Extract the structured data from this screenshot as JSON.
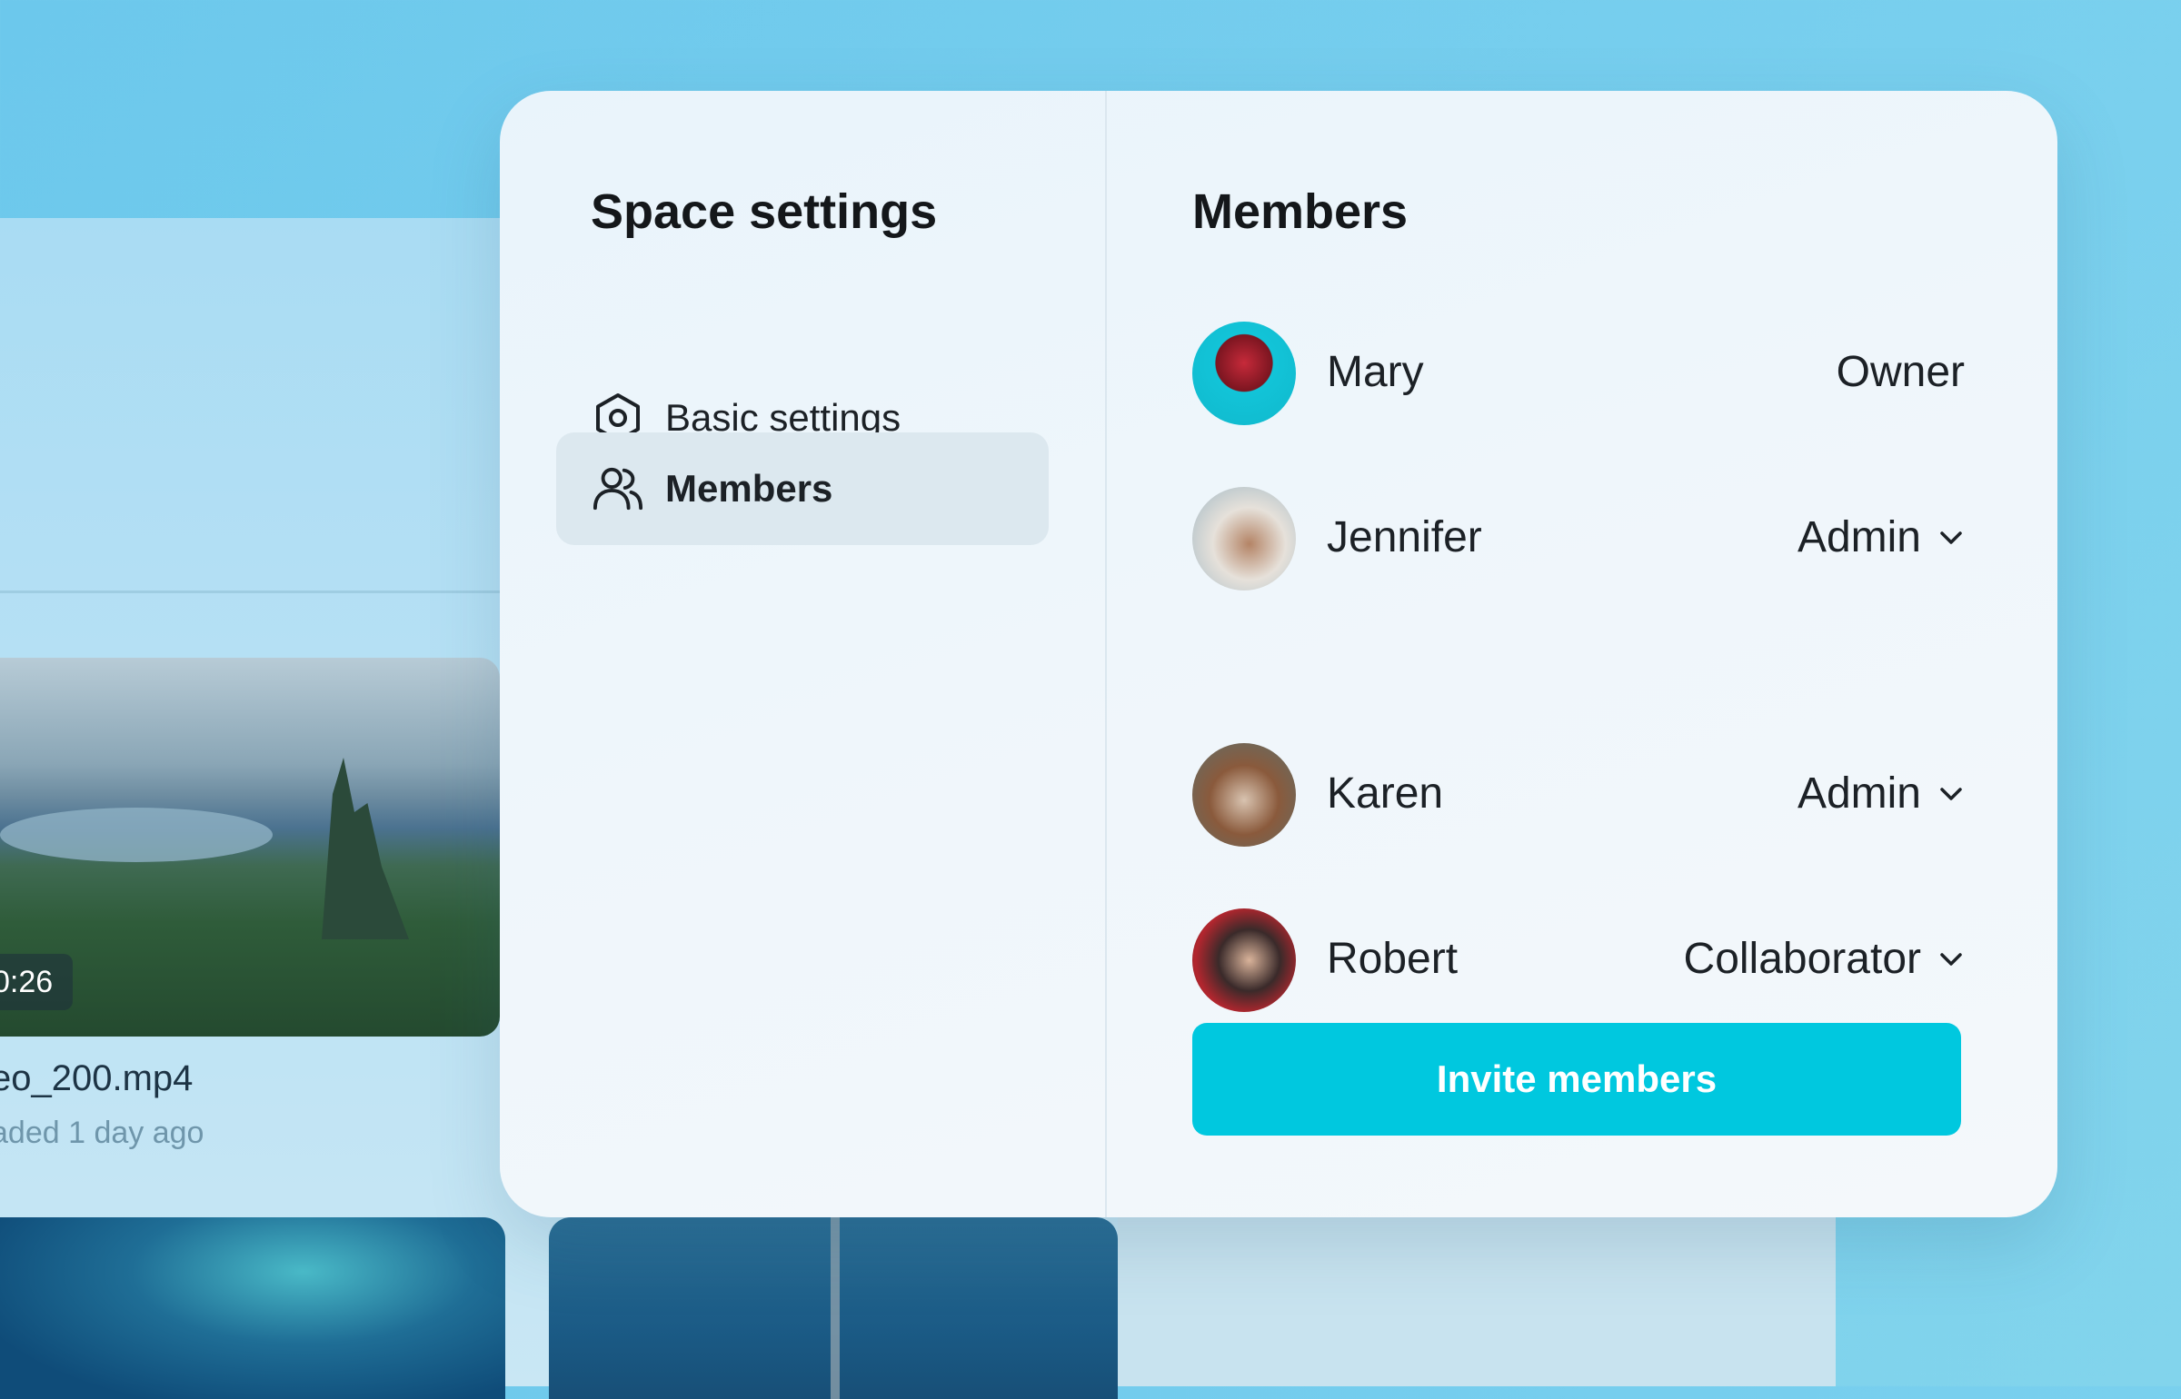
{
  "background": {
    "video": {
      "duration": "0:26",
      "file_name": "eo_200.mp4",
      "uploaded": "aded 1 day ago"
    }
  },
  "modal": {
    "left": {
      "title": "Space settings",
      "nav": [
        {
          "label": "Basic settings",
          "icon": "hexagon-settings-icon",
          "active": false
        },
        {
          "label": "Members",
          "icon": "users-icon",
          "active": true
        }
      ]
    },
    "right": {
      "title": "Members",
      "members": [
        {
          "name": "Mary",
          "role": "Owner",
          "has_dropdown": false
        },
        {
          "name": "Jennifer",
          "role": "Admin",
          "has_dropdown": true
        },
        {
          "name": "Karen",
          "role": "Admin",
          "has_dropdown": true
        },
        {
          "name": "Robert",
          "role": "Collaborator",
          "has_dropdown": true
        }
      ],
      "invite_label": "Invite members"
    }
  },
  "colors": {
    "accent": "#00c8df",
    "active_nav_bg": "#dce8ef",
    "text": "#1c2126"
  }
}
